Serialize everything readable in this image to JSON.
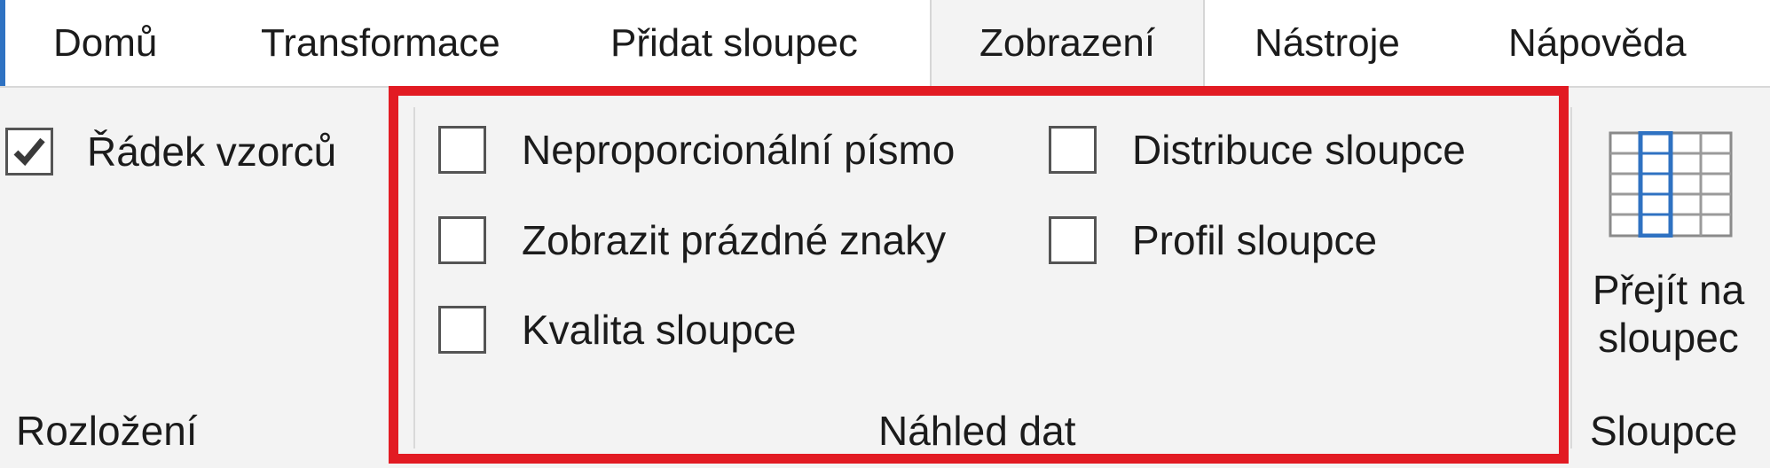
{
  "tabs": [
    {
      "label": "Domů"
    },
    {
      "label": "Transformace"
    },
    {
      "label": "Přidat sloupec"
    },
    {
      "label": "Zobrazení",
      "active": true
    },
    {
      "label": "Nástroje"
    },
    {
      "label": "Nápověda"
    }
  ],
  "layout_group": {
    "formula_bar": {
      "label": "Řádek vzorců",
      "checked": true
    },
    "group_label": "Rozložení"
  },
  "data_preview_group": {
    "monospaced": {
      "label": "Neproporcionální písmo",
      "checked": false
    },
    "show_whitespace": {
      "label": "Zobrazit prázdné znaky",
      "checked": false
    },
    "column_quality": {
      "label": "Kvalita sloupce",
      "checked": false
    },
    "column_distribution": {
      "label": "Distribuce sloupce",
      "checked": false
    },
    "column_profile": {
      "label": "Profil sloupce",
      "checked": false
    },
    "group_label": "Náhled dat"
  },
  "columns_group": {
    "go_to_column": {
      "line1": "Přejít na",
      "line2": "sloupec",
      "icon": "go-to-column-icon"
    },
    "group_label": "Sloupce"
  },
  "colors": {
    "accent": "#2f72c2",
    "highlight": "#e21b23",
    "ribbon_bg": "#f3f3f3"
  }
}
